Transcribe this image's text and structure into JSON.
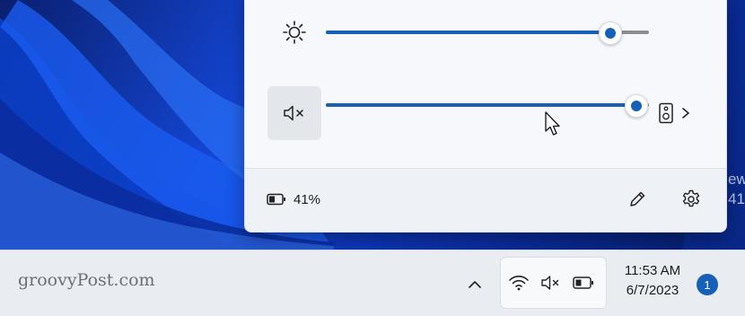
{
  "wallpaper": {
    "edge_text_1": "ew",
    "edge_text_2": "41"
  },
  "quick_settings": {
    "brightness": {
      "icon": "brightness-sun-icon",
      "level": 0.88
    },
    "volume": {
      "icon": "volume-muted-icon",
      "level": 0.96,
      "output_icon": "speaker-device-icon",
      "output_chevron": "chevron-right-icon"
    },
    "battery_percent": "41%",
    "edit_icon": "pencil-icon",
    "settings_icon": "gear-icon"
  },
  "taskbar": {
    "watermark": "groovyPost.com",
    "overflow_icon": "chevron-up-icon",
    "tray": {
      "wifi_icon": "wifi-icon",
      "volume_icon": "volume-muted-icon",
      "battery_icon": "battery-icon"
    },
    "time": "11:53 AM",
    "date": "6/7/2023",
    "notification_count": "1"
  },
  "colors": {
    "accent": "#1760b8",
    "flyout_bg": "#f3f5f9",
    "taskbar_bg": "#e9edf2"
  }
}
